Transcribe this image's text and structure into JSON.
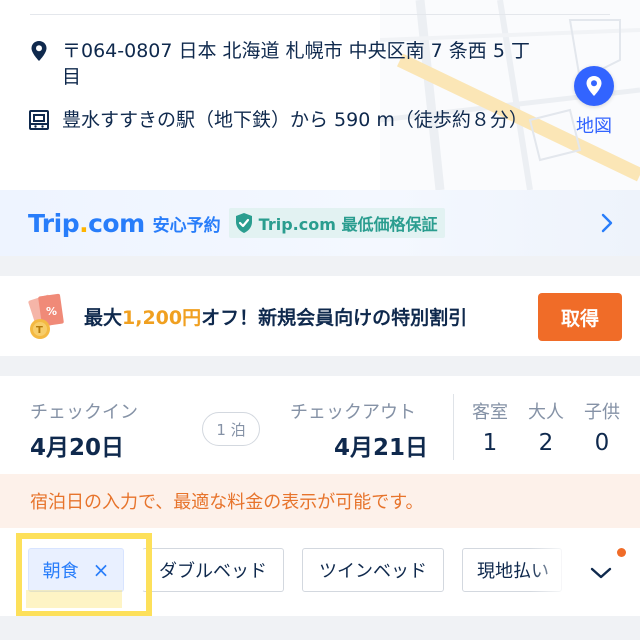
{
  "address": {
    "postal_address": "〒064-0807 日本 北海道 札幌市 中央区南 7 条西 5 丁目",
    "station_access": "豊水すすきの駅（地下鉄）から 590 m（徒歩約８分）",
    "map_label": "地図",
    "icons": {
      "location": "location-pin-icon",
      "station": "train-station-icon",
      "map": "map-pin-icon"
    }
  },
  "trip_banner": {
    "logo_main": "Trip",
    "logo_dot": ".",
    "logo_tail": "com",
    "safe_booking": "安心予約",
    "guarantee": "Trip.com 最低価格保証"
  },
  "promo": {
    "prefix": "最大",
    "amount": "1,200円",
    "suffix": "オフ！新規会員向けの特別割引",
    "button": "取得"
  },
  "dates": {
    "checkin_label": "チェックイン",
    "checkin_value": "4月20日",
    "nights": "1 泊",
    "checkout_label": "チェックアウト",
    "checkout_value": "4月21日"
  },
  "guests": {
    "rooms_label": "客室",
    "rooms": "1",
    "adults_label": "大人",
    "adults": "2",
    "children_label": "子供",
    "children": "0"
  },
  "notice": "宿泊日の入力で、最適な料金の表示が可能です。",
  "filters": {
    "chips": [
      "朝食",
      "ダブルベッド",
      "ツインベッド",
      "現地払い"
    ],
    "remove_symbol": "×"
  },
  "colors": {
    "brand_blue": "#287dfa",
    "map_button": "#3264ff",
    "promo_button": "#f06c28",
    "highlight": "#fde05a",
    "notice_text": "#e7742c"
  }
}
